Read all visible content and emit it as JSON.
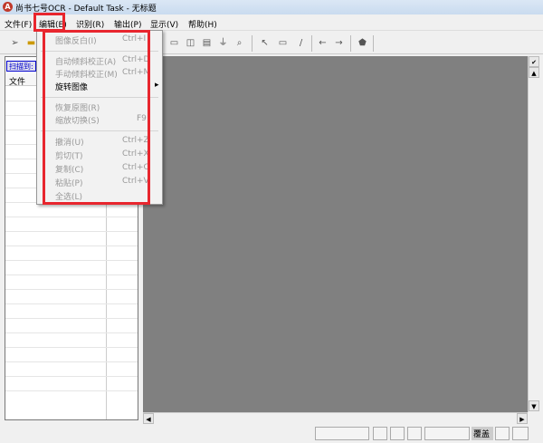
{
  "window": {
    "title": "尚书七号OCR - Default Task - 无标题",
    "logo": "A"
  },
  "menubar": [
    {
      "label": "文件(F)"
    },
    {
      "label": "编辑(E)"
    },
    {
      "label": "识别(R)"
    },
    {
      "label": "输出(P)"
    },
    {
      "label": "显示(V)"
    },
    {
      "label": "帮助(H)"
    }
  ],
  "left_panel": {
    "scan_label": "扫描到:",
    "column_header": "文件"
  },
  "edit_menu": {
    "items": [
      {
        "label": "图像反白(I)",
        "shortcut": "Ctrl+I",
        "enabled": false
      },
      {
        "label": "自动倾斜校正(A)",
        "shortcut": "Ctrl+D",
        "enabled": false
      },
      {
        "label": "手动倾斜校正(M)",
        "shortcut": "Ctrl+M",
        "enabled": false
      },
      {
        "label": "旋转图像",
        "shortcut": "▸",
        "enabled": true
      },
      {
        "label": "恢复原图(R)",
        "shortcut": "",
        "enabled": false
      },
      {
        "label": "缩放切换(S)",
        "shortcut": "F9",
        "enabled": false
      },
      {
        "label": "撤消(U)",
        "shortcut": "Ctrl+Z",
        "enabled": false
      },
      {
        "label": "剪切(T)",
        "shortcut": "Ctrl+X",
        "enabled": false
      },
      {
        "label": "复制(C)",
        "shortcut": "Ctrl+C",
        "enabled": false
      },
      {
        "label": "粘贴(P)",
        "shortcut": "Ctrl+V",
        "enabled": false
      },
      {
        "label": "全选(L)",
        "shortcut": "",
        "enabled": false
      }
    ]
  },
  "status": {
    "mode": "覆盖"
  },
  "colors": {
    "highlight": "#e8262e",
    "canvas": "#808080"
  }
}
